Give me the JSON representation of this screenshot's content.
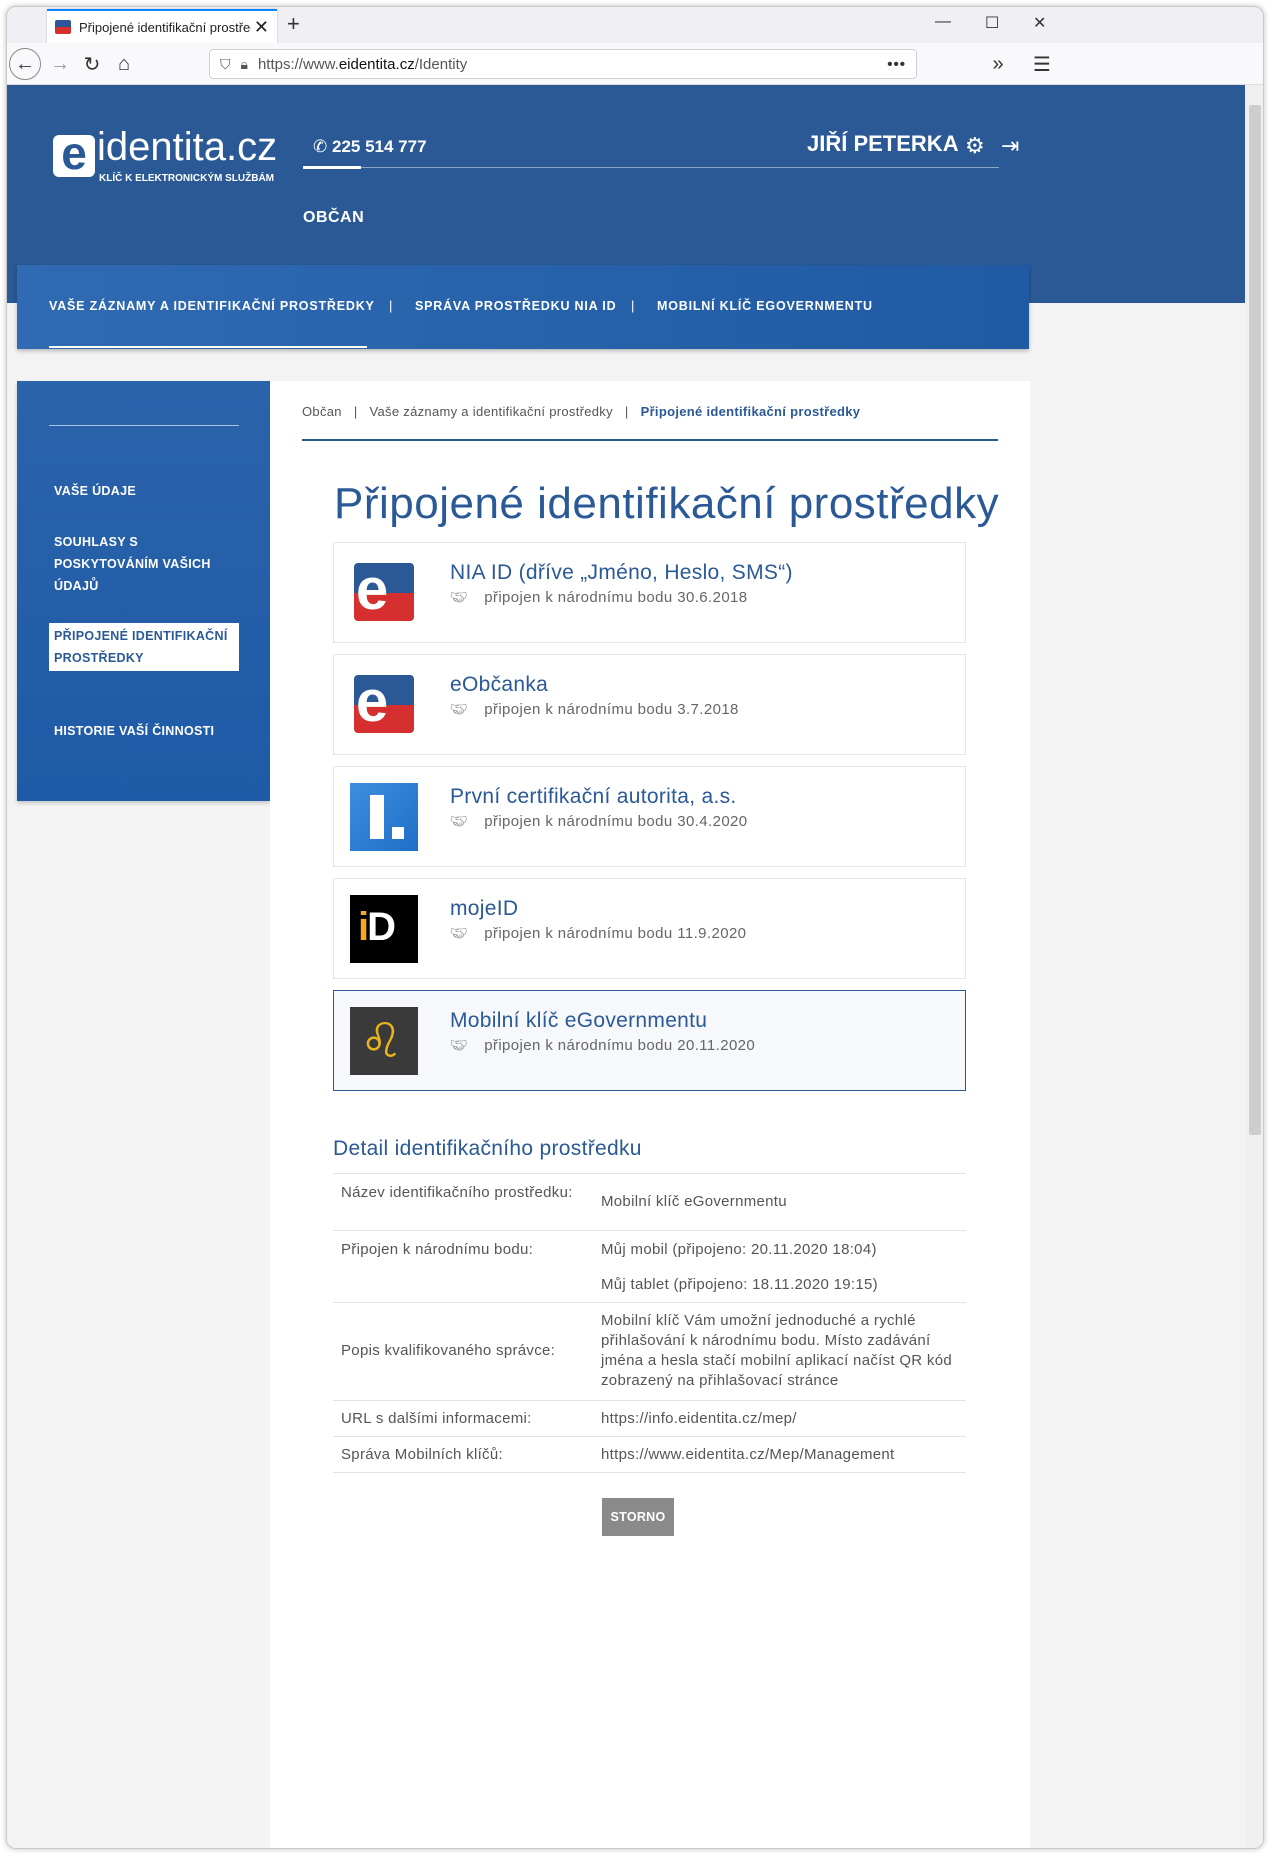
{
  "browser": {
    "tab_title": "Připojené identifikační prostředky",
    "url_scheme": "https://www.",
    "url_host": "eidentita.cz",
    "url_path": "/Identity"
  },
  "header": {
    "logo_name": "identita.cz",
    "logo_tagline": "KLÍČ K ELEKTRONICKÝM SLUŽBÁM",
    "phone": "225 514 777",
    "user_name": "JIŘÍ PETERKA",
    "section": "OBČAN"
  },
  "main_nav": {
    "items": [
      "VAŠE ZÁZNAMY A IDENTIFIKAČNÍ PROSTŘEDKY",
      "SPRÁVA PROSTŘEDKU NIA ID",
      "MOBILNÍ KLÍČ EGOVERNMENTU"
    ],
    "separator": "|"
  },
  "sidebar": {
    "items": [
      "VAŠE ÚDAJE",
      "SOUHLASY S POSKYTOVÁNÍM VAŠICH ÚDAJŮ",
      "PŘIPOJENÉ IDENTIFIKAČNÍ PROSTŘEDKY",
      "HISTORIE VAŠÍ ČINNOSTI"
    ],
    "active_index": 2
  },
  "breadcrumb": {
    "items": [
      "Občan",
      "Vaše záznamy a identifikační prostředky",
      "Připojené identifikační prostředky"
    ],
    "separator": "|"
  },
  "page_title": "Připojené identifikační prostředky",
  "providers": [
    {
      "name": "NIA ID (dříve „Jméno, Heslo, SMS“)",
      "connected": "připojen k národnímu bodu 30.6.2018",
      "logo": "eidentita-logo"
    },
    {
      "name": "eObčanka",
      "connected": "připojen k národnímu bodu 3.7.2018",
      "logo": "eidentita-logo"
    },
    {
      "name": "První certifikační autorita, a.s.",
      "connected": "připojen k národnímu bodu 30.4.2020",
      "logo": "ica-logo"
    },
    {
      "name": "mojeID",
      "connected": "připojen k národnímu bodu 11.9.2020",
      "logo": "mojeid-logo"
    },
    {
      "name": "Mobilní klíč eGovernmentu",
      "connected": "připojen k národnímu bodu 20.11.2020",
      "logo": "czech-lion-logo",
      "selected": true
    }
  ],
  "detail": {
    "heading": "Detail identifikačního prostředku",
    "rows": [
      {
        "label": "Název identifikačního prostředku:",
        "value": "Mobilní klíč eGovernmentu"
      },
      {
        "label": "Připojen k národnímu bodu:",
        "value": "Můj mobil (připojeno: 20.11.2020 18:04)",
        "value2": "Můj tablet (připojeno: 18.11.2020 19:15)"
      },
      {
        "label": "Popis kvalifikovaného správce:",
        "value": "Mobilní klíč Vám umožní jednoduché a rychlé přihlašování k národnímu bodu. Místo zadávání jména a hesla stačí mobilní aplikací načíst QR kód zobrazený na přihlašovací stránce"
      },
      {
        "label": "URL s dalšími informacemi:",
        "value": "https://info.eidentita.cz/mep/"
      },
      {
        "label": "Správa Mobilních klíčů:",
        "value": "https://www.eidentita.cz/Mep/Management"
      }
    ]
  },
  "buttons": {
    "storno": "STORNO"
  },
  "colors": {
    "brand_blue": "#2a5996",
    "brand_red": "#d62f2f",
    "button_gray": "#8a8a8a"
  }
}
